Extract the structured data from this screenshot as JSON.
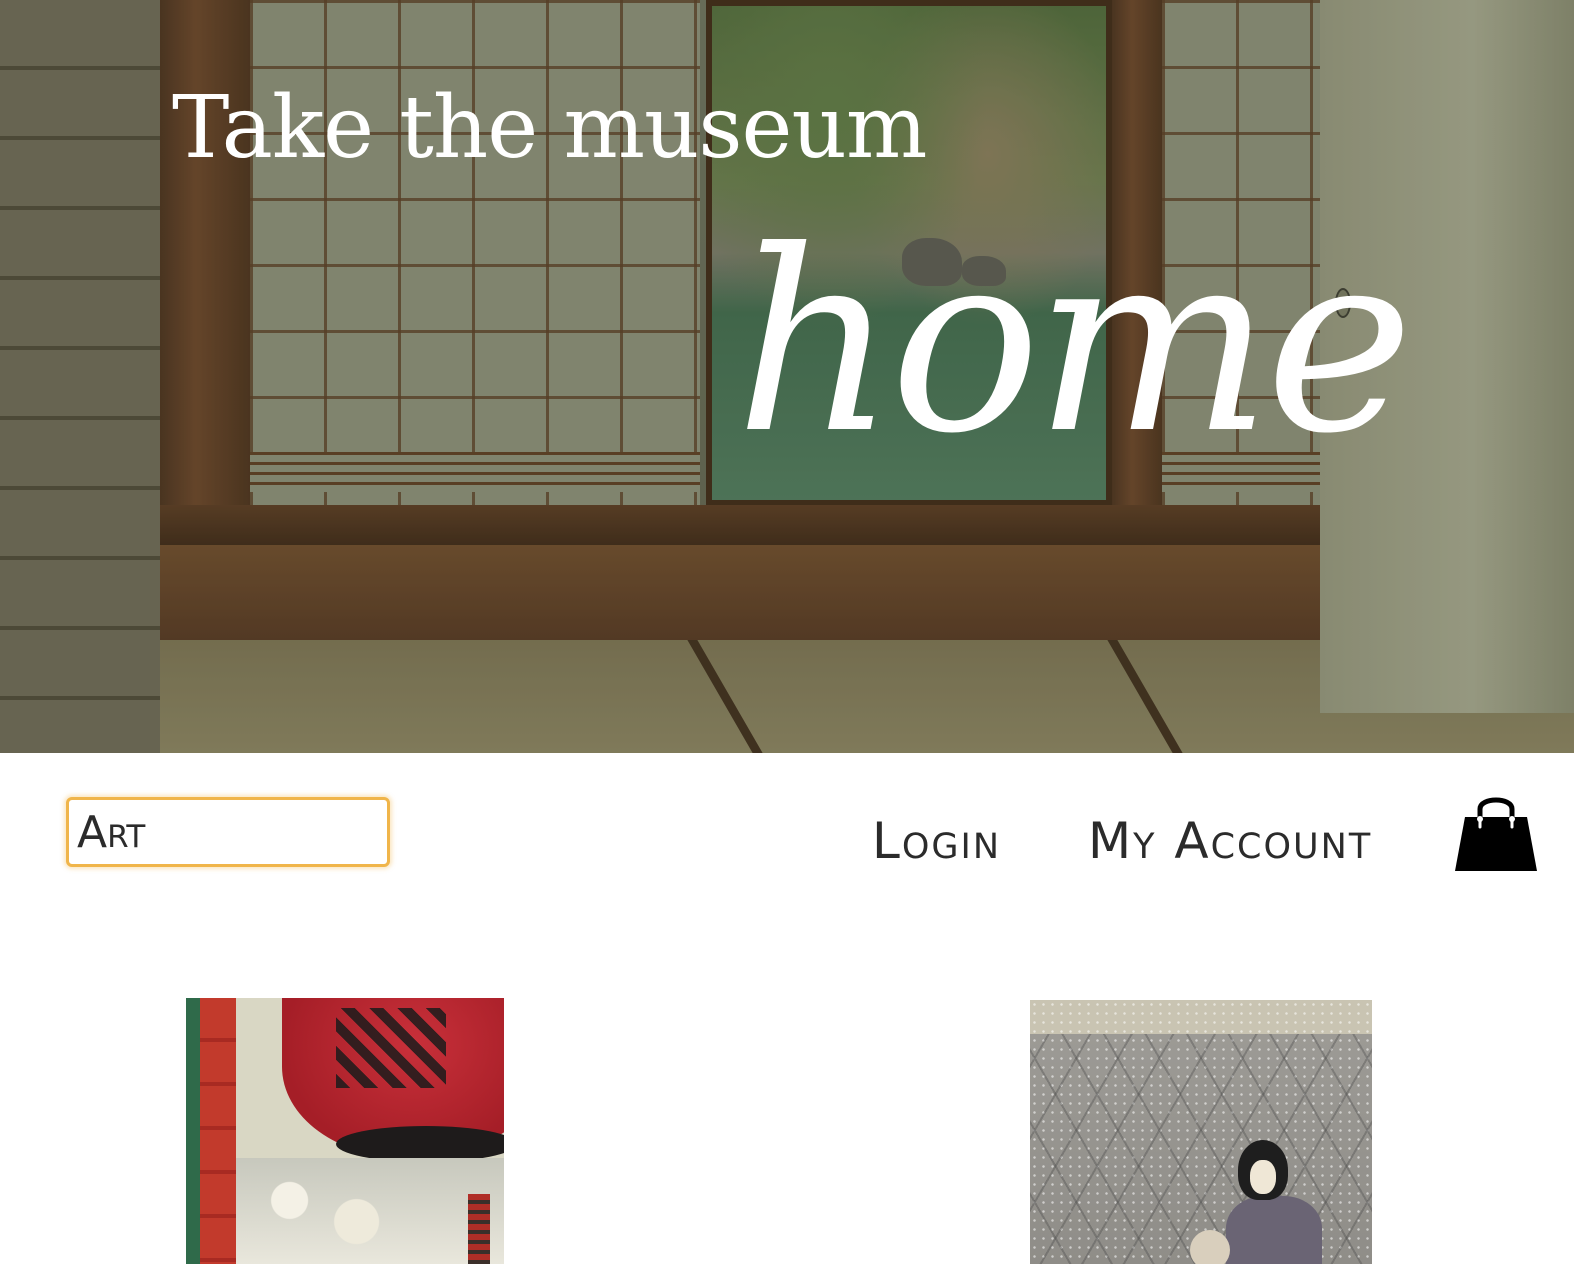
{
  "hero": {
    "title_line": "Take the museum",
    "title_script": "home"
  },
  "nav": {
    "search": {
      "value": "Art",
      "placeholder": ""
    },
    "links": {
      "login": "Login",
      "my_account": "My Account"
    },
    "cart_icon": "shopping-bag-icon",
    "search_focus_color": "#f0b54a",
    "text_color": "#2b2b2b"
  },
  "products": [
    {
      "image": "ukiyo-e-lantern-print"
    },
    {
      "image": "ukiyo-e-snow-figure-print"
    }
  ]
}
